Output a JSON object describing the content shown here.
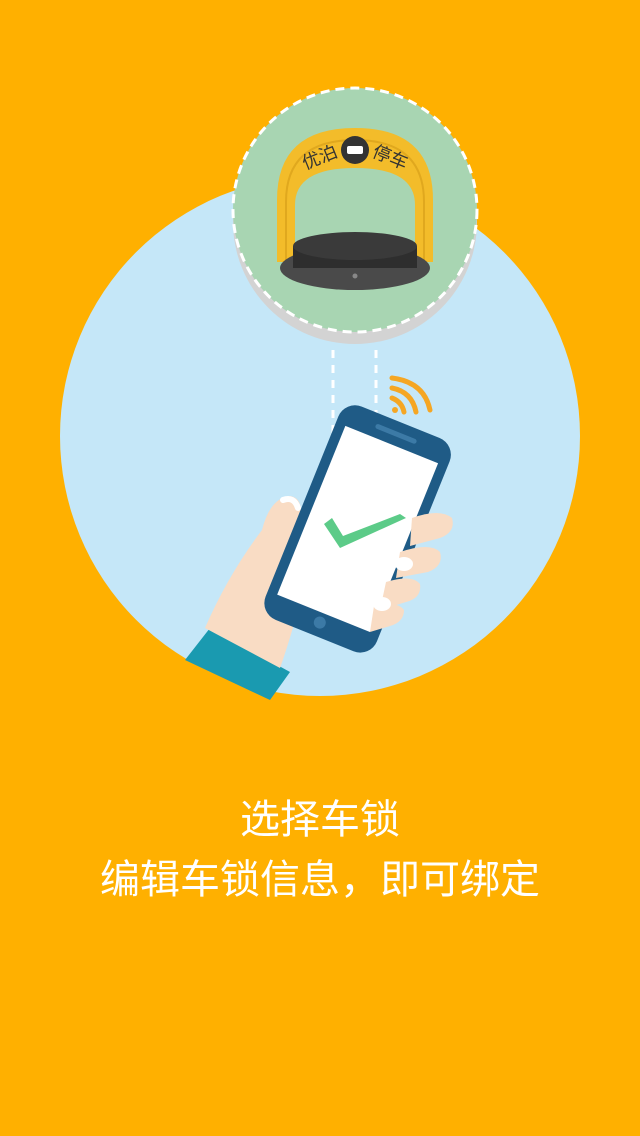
{
  "colors": {
    "background": "#FFB000",
    "circle": "#C5E7F8",
    "lock_badge": "#A8D5B2",
    "phone_body": "#1F5B86",
    "check": "#5CCB88",
    "sleeve": "#1A9AB0",
    "skin": "#F9DCC4"
  },
  "illustration": {
    "lock_brand_left": "优泊",
    "lock_brand_right": "停车",
    "phone_screen_icon": "check-mark-icon",
    "signal_icon": "wifi-signal-icon",
    "lock_icon": "parking-lock-icon"
  },
  "caption": {
    "title": "选择车锁",
    "subtitle": "编辑车锁信息，即可绑定"
  }
}
